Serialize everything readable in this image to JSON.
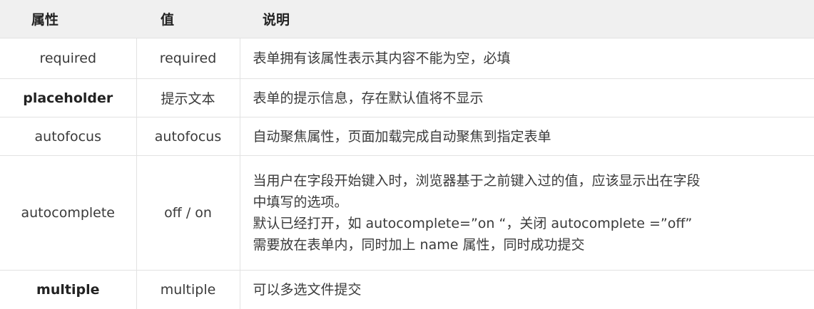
{
  "headers": {
    "attr": "属性",
    "value": "值",
    "desc": "说明"
  },
  "rows": [
    {
      "attr": "required",
      "value": "required",
      "desc": [
        "表单拥有该属性表示其内容不能为空，必填"
      ]
    },
    {
      "attr": "placeholder",
      "value": "提示文本",
      "desc": [
        "表单的提示信息，存在默认值将不显示"
      ]
    },
    {
      "attr": "autofocus",
      "value": "autofocus",
      "desc": [
        "自动聚焦属性，页面加载完成自动聚焦到指定表单"
      ]
    },
    {
      "attr": "autocomplete",
      "value": "off / on",
      "desc": [
        "当用户在字段开始键入时，浏览器基于之前键入过的值，应该显示出在字段",
        "中填写的选项。",
        "默认已经打开，如 autocomplete=”on “，关闭 autocomplete =”off”",
        "需要放在表单内，同时加上 name 属性，同时成功提交"
      ]
    },
    {
      "attr": "multiple",
      "value": "multiple",
      "desc": [
        "可以多选文件提交"
      ]
    }
  ]
}
